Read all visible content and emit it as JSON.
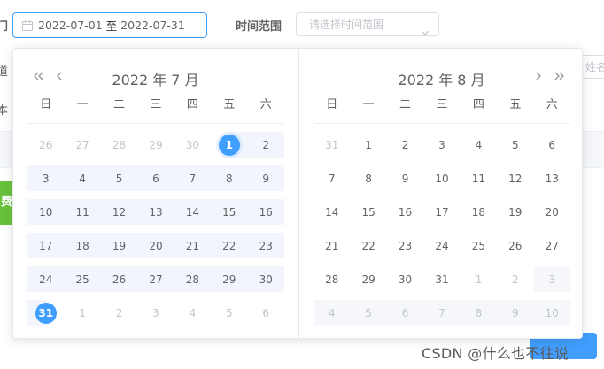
{
  "filters": {
    "date_range": {
      "start": "2022-07-01",
      "separator": "至",
      "end": "2022-07-31"
    },
    "time_range": {
      "label": "时间范围",
      "placeholder": "请选择时间范围"
    },
    "name_placeholder": "姓名"
  },
  "edge_fragments": {
    "label_1": "门",
    "label_2": "道",
    "label_3": "本",
    "green_tag": "费"
  },
  "picker": {
    "weekdays": [
      "日",
      "一",
      "二",
      "三",
      "四",
      "五",
      "六"
    ],
    "left": {
      "title": "2022 年 7 月",
      "weeks": [
        [
          {
            "d": "26",
            "t": "other"
          },
          {
            "d": "27",
            "t": "other"
          },
          {
            "d": "28",
            "t": "other"
          },
          {
            "d": "29",
            "t": "other"
          },
          {
            "d": "30",
            "t": "other"
          },
          {
            "d": "1",
            "t": "start"
          },
          {
            "d": "2",
            "t": "in"
          }
        ],
        [
          {
            "d": "3",
            "t": "in"
          },
          {
            "d": "4",
            "t": "in"
          },
          {
            "d": "5",
            "t": "in"
          },
          {
            "d": "6",
            "t": "in"
          },
          {
            "d": "7",
            "t": "in"
          },
          {
            "d": "8",
            "t": "in"
          },
          {
            "d": "9",
            "t": "in"
          }
        ],
        [
          {
            "d": "10",
            "t": "in"
          },
          {
            "d": "11",
            "t": "in"
          },
          {
            "d": "12",
            "t": "in"
          },
          {
            "d": "13",
            "t": "in"
          },
          {
            "d": "14",
            "t": "in"
          },
          {
            "d": "15",
            "t": "in"
          },
          {
            "d": "16",
            "t": "in"
          }
        ],
        [
          {
            "d": "17",
            "t": "in"
          },
          {
            "d": "18",
            "t": "in"
          },
          {
            "d": "19",
            "t": "in"
          },
          {
            "d": "20",
            "t": "in"
          },
          {
            "d": "21",
            "t": "in"
          },
          {
            "d": "22",
            "t": "in"
          },
          {
            "d": "23",
            "t": "in"
          }
        ],
        [
          {
            "d": "24",
            "t": "in"
          },
          {
            "d": "25",
            "t": "in"
          },
          {
            "d": "26",
            "t": "in"
          },
          {
            "d": "27",
            "t": "in"
          },
          {
            "d": "28",
            "t": "in"
          },
          {
            "d": "29",
            "t": "in"
          },
          {
            "d": "30",
            "t": "in"
          }
        ],
        [
          {
            "d": "31",
            "t": "end"
          },
          {
            "d": "1",
            "t": "other"
          },
          {
            "d": "2",
            "t": "other"
          },
          {
            "d": "3",
            "t": "other"
          },
          {
            "d": "4",
            "t": "other"
          },
          {
            "d": "5",
            "t": "other"
          },
          {
            "d": "6",
            "t": "other"
          }
        ]
      ]
    },
    "right": {
      "title": "2022 年 8 月",
      "weeks": [
        [
          {
            "d": "31",
            "t": "other"
          },
          {
            "d": "1",
            "t": "normal"
          },
          {
            "d": "2",
            "t": "normal"
          },
          {
            "d": "3",
            "t": "normal"
          },
          {
            "d": "4",
            "t": "normal"
          },
          {
            "d": "5",
            "t": "normal"
          },
          {
            "d": "6",
            "t": "normal"
          }
        ],
        [
          {
            "d": "7",
            "t": "normal"
          },
          {
            "d": "8",
            "t": "normal"
          },
          {
            "d": "9",
            "t": "normal"
          },
          {
            "d": "10",
            "t": "normal"
          },
          {
            "d": "11",
            "t": "normal"
          },
          {
            "d": "12",
            "t": "normal"
          },
          {
            "d": "13",
            "t": "normal"
          }
        ],
        [
          {
            "d": "14",
            "t": "normal"
          },
          {
            "d": "15",
            "t": "normal"
          },
          {
            "d": "16",
            "t": "normal"
          },
          {
            "d": "17",
            "t": "normal"
          },
          {
            "d": "18",
            "t": "normal"
          },
          {
            "d": "19",
            "t": "normal"
          },
          {
            "d": "20",
            "t": "normal"
          }
        ],
        [
          {
            "d": "21",
            "t": "normal"
          },
          {
            "d": "22",
            "t": "normal"
          },
          {
            "d": "23",
            "t": "normal"
          },
          {
            "d": "24",
            "t": "normal"
          },
          {
            "d": "25",
            "t": "normal"
          },
          {
            "d": "26",
            "t": "normal"
          },
          {
            "d": "27",
            "t": "normal"
          }
        ],
        [
          {
            "d": "28",
            "t": "normal"
          },
          {
            "d": "29",
            "t": "normal"
          },
          {
            "d": "30",
            "t": "normal"
          },
          {
            "d": "31",
            "t": "normal"
          },
          {
            "d": "1",
            "t": "other"
          },
          {
            "d": "2",
            "t": "other"
          },
          {
            "d": "3",
            "t": "disabled"
          }
        ],
        [
          {
            "d": "4",
            "t": "disabled"
          },
          {
            "d": "5",
            "t": "disabled"
          },
          {
            "d": "6",
            "t": "disabled"
          },
          {
            "d": "7",
            "t": "disabled"
          },
          {
            "d": "8",
            "t": "disabled"
          },
          {
            "d": "9",
            "t": "disabled"
          },
          {
            "d": "10",
            "t": "disabled"
          }
        ]
      ]
    }
  },
  "watermark": "CSDN @什么也不往说",
  "colors": {
    "accent": "#409eff",
    "range_bg": "#f2f6fc",
    "success": "#67c23a"
  },
  "icons": [
    "calendar-icon",
    "chevron-down-icon",
    "double-left-arrow-icon",
    "left-arrow-icon",
    "right-arrow-icon",
    "double-right-arrow-icon"
  ]
}
